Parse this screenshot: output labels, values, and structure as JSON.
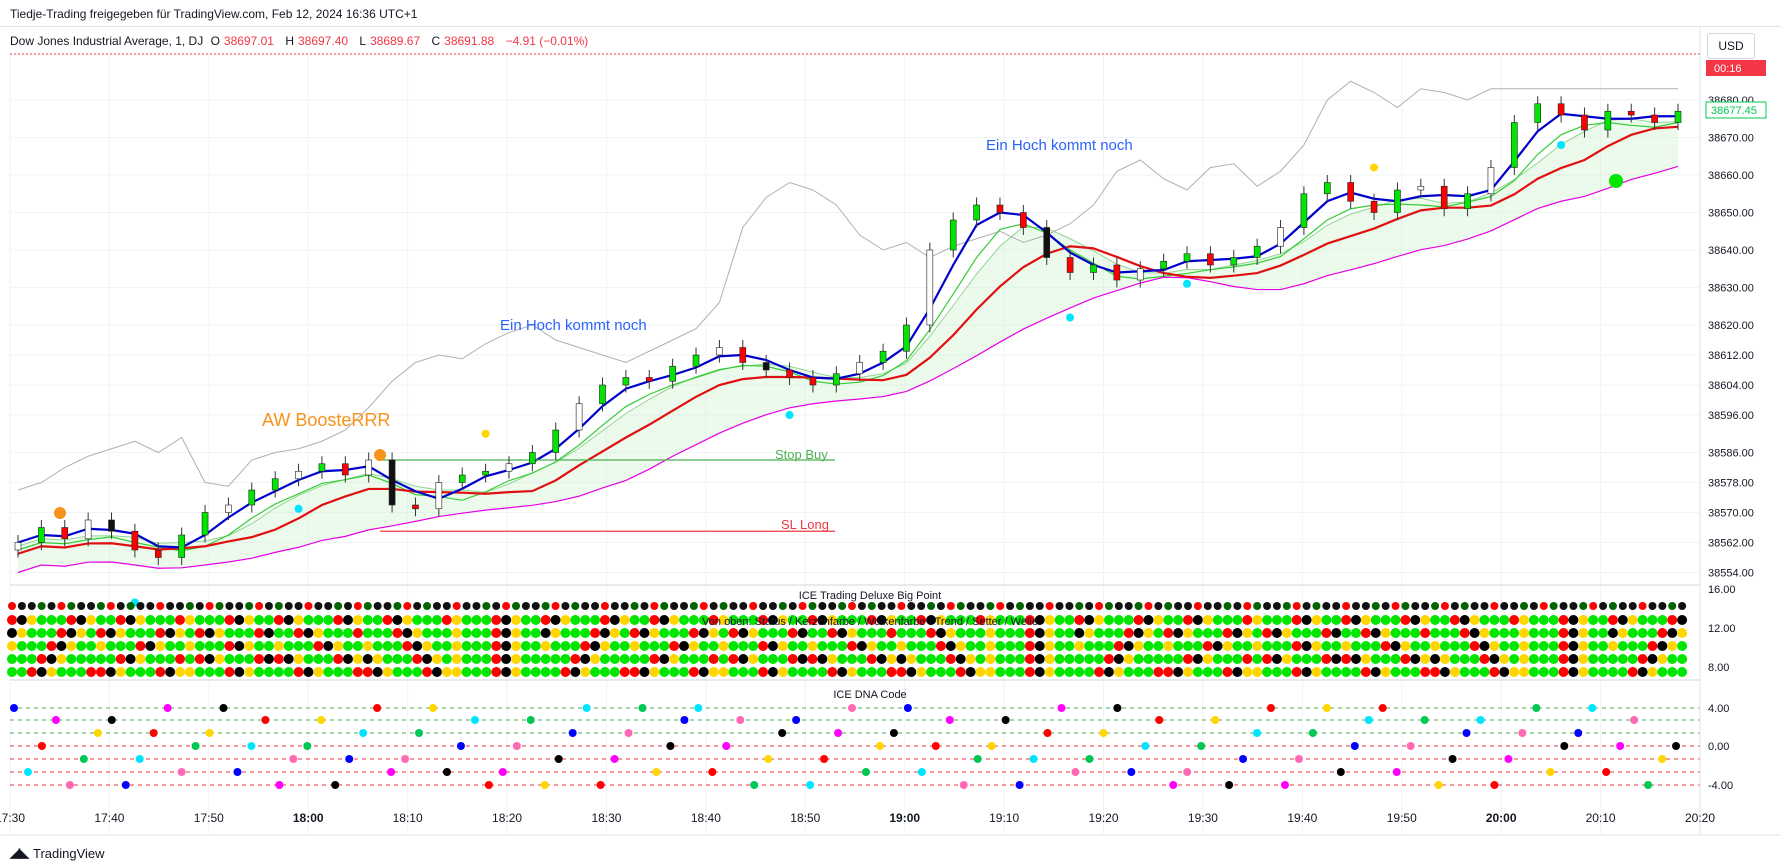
{
  "header": {
    "publisher_line": "Tiedje-Trading freigegeben für TradingView.com, Feb 12, 2024 16:36 UTC+1"
  },
  "legend": {
    "symbol": "Dow Jones Industrial Average, 1, DJ",
    "o_label": "O",
    "o_value": "38697.01",
    "h_label": "H",
    "h_value": "38697.40",
    "l_label": "L",
    "l_value": "38689.67",
    "c_label": "C",
    "c_value": "38691.88",
    "change": "−4.91 (−0.01%)"
  },
  "currency_button": "USD",
  "price_badges": {
    "countdown": "00:16",
    "last_price": "38677.45"
  },
  "annotations": {
    "first_high": "Ein Hoch kommt noch",
    "second_high": "Ein Hoch kommt noch",
    "booster": "AW BoosteRRR",
    "stop_buy": "Stop Buy",
    "sl_long": "SL Long"
  },
  "indicator_titles": {
    "big_point": "ICE Trading Deluxe Big Point",
    "status_rows": "Von oben: Status / Kerzenfarbe / Wolkenfarbe / Trend / Setter / Welle",
    "dna": "ICE DNA Code"
  },
  "branding": {
    "logo_text": "TradingView"
  },
  "colors": {
    "bull": "#00e600",
    "bear": "#ff0000",
    "fast_line": "#0000cc",
    "slow_line": "#e01010",
    "cloud_upper": "#e600e6",
    "price_line_red": "#f23645"
  },
  "chart_data": {
    "type": "candlestick",
    "symbol": "Dow Jones Industrial Average",
    "interval": "1",
    "y_ticks": [
      "38680.00",
      "38670.00",
      "38660.00",
      "38650.00",
      "38640.00",
      "38630.00",
      "38620.00",
      "38612.00",
      "38604.00",
      "38596.00",
      "38586.00",
      "38578.00",
      "38570.00",
      "38562.00",
      "38554.00"
    ],
    "x_ticks": [
      "17:30",
      "17:40",
      "17:50",
      "18:00",
      "18:10",
      "18:20",
      "18:30",
      "18:40",
      "18:50",
      "19:00",
      "19:10",
      "19:20",
      "19:30",
      "19:40",
      "19:50",
      "20:00",
      "20:10",
      "20:20"
    ],
    "x_ticks_bold": [
      "18:00",
      "19:00",
      "20:00"
    ],
    "ylim": [
      38552,
      38692
    ],
    "close_series_approx": [
      38562,
      38566,
      38563,
      38568,
      38565,
      38560,
      38558,
      38564,
      38570,
      38572,
      38576,
      38579,
      38581,
      38583,
      38580,
      38584,
      38572,
      38571,
      38578,
      38580,
      38581,
      38583,
      38586,
      38592,
      38599,
      38604,
      38606,
      38605,
      38609,
      38612,
      38614,
      38610,
      38608,
      38606,
      38604,
      38607,
      38610,
      38613,
      38620,
      38640,
      38648,
      38652,
      38650,
      38646,
      38638,
      38634,
      38636,
      38632,
      38635,
      38637,
      38639,
      38636,
      38638,
      38641,
      38646,
      38655,
      38658,
      38653,
      38650,
      38656,
      38657,
      38651,
      38655,
      38662,
      38674,
      38679,
      38676,
      38672,
      38677,
      38676,
      38674,
      38677
    ],
    "stop_buy": 38584,
    "sl_long": 38565,
    "indicator_pane_1": {
      "title": "ICE Trading Deluxe Big Point",
      "y_ticks": [
        "16.00",
        "12.00",
        "8.00"
      ]
    },
    "indicator_pane_2": {
      "title": "ICE DNA Code",
      "y_ticks": [
        "4.00",
        "0.00",
        "-4.00"
      ]
    }
  }
}
